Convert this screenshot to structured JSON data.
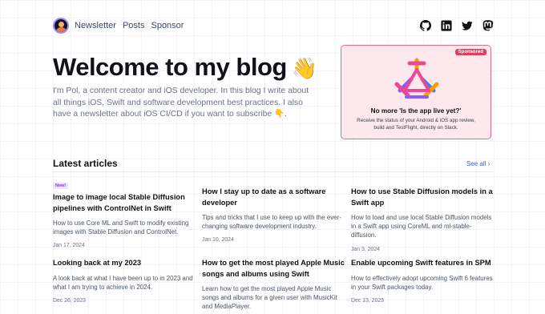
{
  "header": {
    "nav": [
      "Newsletter",
      "Posts",
      "Sponsor"
    ],
    "social_icons": [
      "github-icon",
      "linkedin-icon",
      "twitter-icon",
      "mastodon-icon"
    ]
  },
  "hero": {
    "title": "Welcome to my blog",
    "emoji": "👋",
    "description": "I'm Pol, a content creator and iOS developer. In this blog I write about all things iOS, Swift and software development best practices. I also have a newsletter about iOS CI/CD if you want to subscribe 👇."
  },
  "sponsor": {
    "badge": "Sponsored",
    "title": "No more 'Is the app live yet?'",
    "text": "Receive the status of your Android & iOS app review, build and TestFlight, directly on Slack.",
    "logo_colors": [
      "#f59e0b",
      "#ec4899",
      "#8b5cf6",
      "#3b82f6"
    ]
  },
  "latest": {
    "title": "Latest articles",
    "see_all": "See all",
    "articles": [
      {
        "badge": "New!",
        "title": "Image to image local Stable Diffusion pipelines with ControlNet in Swift",
        "description": "How to use Core ML and Swift to modify existing images with Stable Diffusion and ControlNet.",
        "date": "Jan 17, 2024"
      },
      {
        "title": "How I stay up to date as a software developer",
        "description": "Tips and tricks that I use to keep up with the ever-changing software development industry.",
        "date": "Jan 10, 2024"
      },
      {
        "title": "How to use Stable Diffusion models in a Swift app",
        "description": "How to load and use local Stable Diffusion models in a Swift app using CoreML and ml-stable-diffusion.",
        "date": "Jan 3, 2024"
      },
      {
        "title": "Looking back at my 2023",
        "description": "A look back at what I have been up to in 2023 and what I am trying to achieve in 2024.",
        "date": "Dec 26, 2023"
      },
      {
        "title": "How to get the most played Apple Music songs and albums using Swift",
        "description": "Learn how to get the most played Apple Music songs and albums for a given user with MusicKit and MediaPlayer.",
        "date": ""
      },
      {
        "title": "Enable upcoming Swift features in SPM",
        "description": "How to effectively adopt upcoming Swift 6 features in your Swift packages today.",
        "date": "Dec 13, 2023"
      }
    ]
  },
  "colors": {
    "accent": "#3b5bdb",
    "sponsor_bg": "#fde8ee",
    "sponsor_border": "#e46d8a",
    "new_badge": "#7c3aed"
  }
}
